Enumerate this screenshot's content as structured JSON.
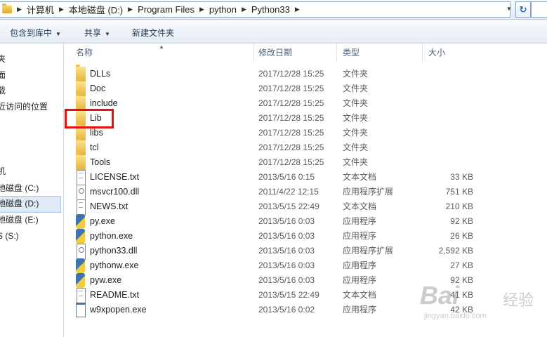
{
  "address_bar": {
    "breadcrumbs": [
      "计算机",
      "本地磁盘 (D:)",
      "Program Files",
      "python",
      "Python33"
    ]
  },
  "toolbar": {
    "include_label": "包含到库中",
    "share_label": "共享",
    "new_folder_label": "新建文件夹"
  },
  "nav": {
    "items": [
      "夹",
      "面",
      "载",
      "近访问的位置",
      "机",
      "地磁盘 (C:)",
      "地磁盘 (D:)",
      "地磁盘 (E:)",
      "S (S:)"
    ]
  },
  "columns": {
    "name": "名称",
    "date": "修改日期",
    "type": "类型",
    "size": "大小"
  },
  "files": [
    {
      "name": "DLLs",
      "date": "2017/12/28 15:25",
      "type": "文件夹",
      "size": "",
      "icon": "folder-icon"
    },
    {
      "name": "Doc",
      "date": "2017/12/28 15:25",
      "type": "文件夹",
      "size": "",
      "icon": "folder-icon"
    },
    {
      "name": "include",
      "date": "2017/12/28 15:25",
      "type": "文件夹",
      "size": "",
      "icon": "folder-icon"
    },
    {
      "name": "Lib",
      "date": "2017/12/28 15:25",
      "type": "文件夹",
      "size": "",
      "icon": "folder-icon"
    },
    {
      "name": "libs",
      "date": "2017/12/28 15:25",
      "type": "文件夹",
      "size": "",
      "icon": "folder-icon"
    },
    {
      "name": "tcl",
      "date": "2017/12/28 15:25",
      "type": "文件夹",
      "size": "",
      "icon": "folder-icon"
    },
    {
      "name": "Tools",
      "date": "2017/12/28 15:25",
      "type": "文件夹",
      "size": "",
      "icon": "folder-icon"
    },
    {
      "name": "LICENSE.txt",
      "date": "2013/5/16 0:15",
      "type": "文本文档",
      "size": "33 KB",
      "icon": "text-file-icon"
    },
    {
      "name": "msvcr100.dll",
      "date": "2011/4/22 12:15",
      "type": "应用程序扩展",
      "size": "751 KB",
      "icon": "dll-file-icon"
    },
    {
      "name": "NEWS.txt",
      "date": "2013/5/15 22:49",
      "type": "文本文档",
      "size": "210 KB",
      "icon": "text-file-icon"
    },
    {
      "name": "py.exe",
      "date": "2013/5/16 0:03",
      "type": "应用程序",
      "size": "92 KB",
      "icon": "python-icon"
    },
    {
      "name": "python.exe",
      "date": "2013/5/16 0:03",
      "type": "应用程序",
      "size": "26 KB",
      "icon": "python-icon"
    },
    {
      "name": "python33.dll",
      "date": "2013/5/16 0:03",
      "type": "应用程序扩展",
      "size": "2,592 KB",
      "icon": "dll-file-icon"
    },
    {
      "name": "pythonw.exe",
      "date": "2013/5/16 0:03",
      "type": "应用程序",
      "size": "27 KB",
      "icon": "python-icon"
    },
    {
      "name": "pyw.exe",
      "date": "2013/5/16 0:03",
      "type": "应用程序",
      "size": "92 KB",
      "icon": "python-icon"
    },
    {
      "name": "README.txt",
      "date": "2013/5/15 22:49",
      "type": "文本文档",
      "size": "41 KB",
      "icon": "text-file-icon"
    },
    {
      "name": "w9xpopen.exe",
      "date": "2013/5/16 0:02",
      "type": "应用程序",
      "size": "42 KB",
      "icon": "exe-file-icon"
    }
  ],
  "highlighted_item": "Lib",
  "watermark": {
    "brand": "Bai",
    "cn": "经验",
    "url": "jingyan.baidu.com"
  },
  "colors": {
    "highlight_box": "#e01010",
    "selection": "#dfeaf7"
  }
}
